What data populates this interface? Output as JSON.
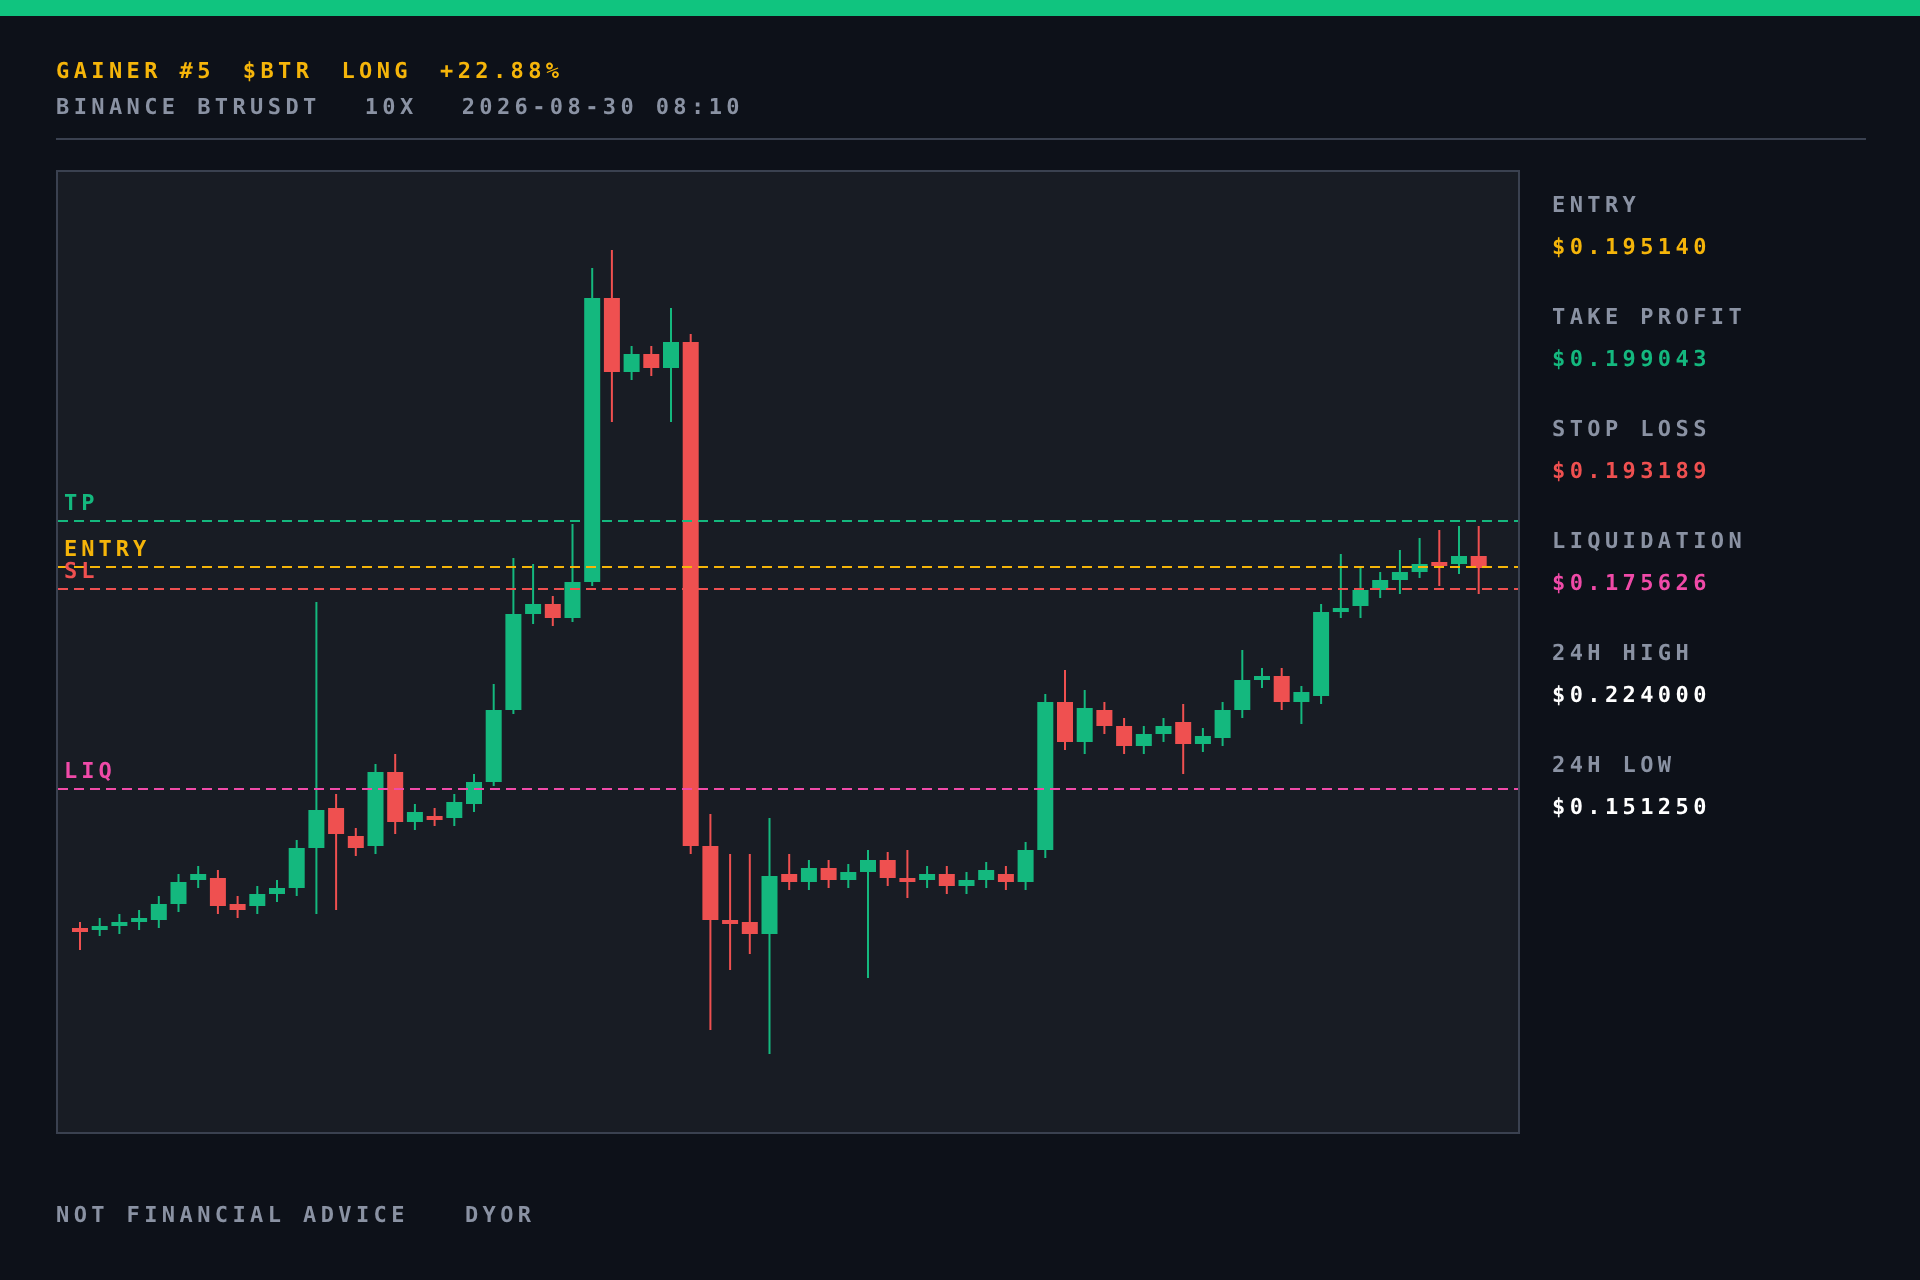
{
  "header": {
    "headline": [
      {
        "text": "GAINER #5"
      },
      {
        "text": "$BTR"
      },
      {
        "text": "LONG"
      },
      {
        "text": "+22.88%"
      }
    ],
    "details": [
      "BINANCE BTRUSDT",
      "10X",
      "2026-08-30 08:10"
    ]
  },
  "chart": {
    "levels": [
      {
        "label": "TP",
        "color": "#14b87e"
      },
      {
        "label": "ENTRY",
        "color": "#f5b50a"
      },
      {
        "label": "SL",
        "color": "#ef5050"
      },
      {
        "label": "LIQ",
        "color": "#f04aa8"
      }
    ]
  },
  "stats": [
    {
      "label": "ENTRY",
      "value": "$0.195140",
      "color": "#f5b50a"
    },
    {
      "label": "TAKE PROFIT",
      "value": "$0.199043",
      "color": "#14b87e"
    },
    {
      "label": "STOP LOSS",
      "value": "$0.193189",
      "color": "#ef5050"
    },
    {
      "label": "LIQUIDATION",
      "value": "$0.175626",
      "color": "#f04aa8"
    },
    {
      "label": "24H HIGH",
      "value": "$0.224000",
      "color": "#ffffff"
    },
    {
      "label": "24H LOW",
      "value": "$0.151250",
      "color": "#ffffff"
    }
  ],
  "footer": [
    "NOT FINANCIAL ADVICE",
    "DYOR"
  ]
}
